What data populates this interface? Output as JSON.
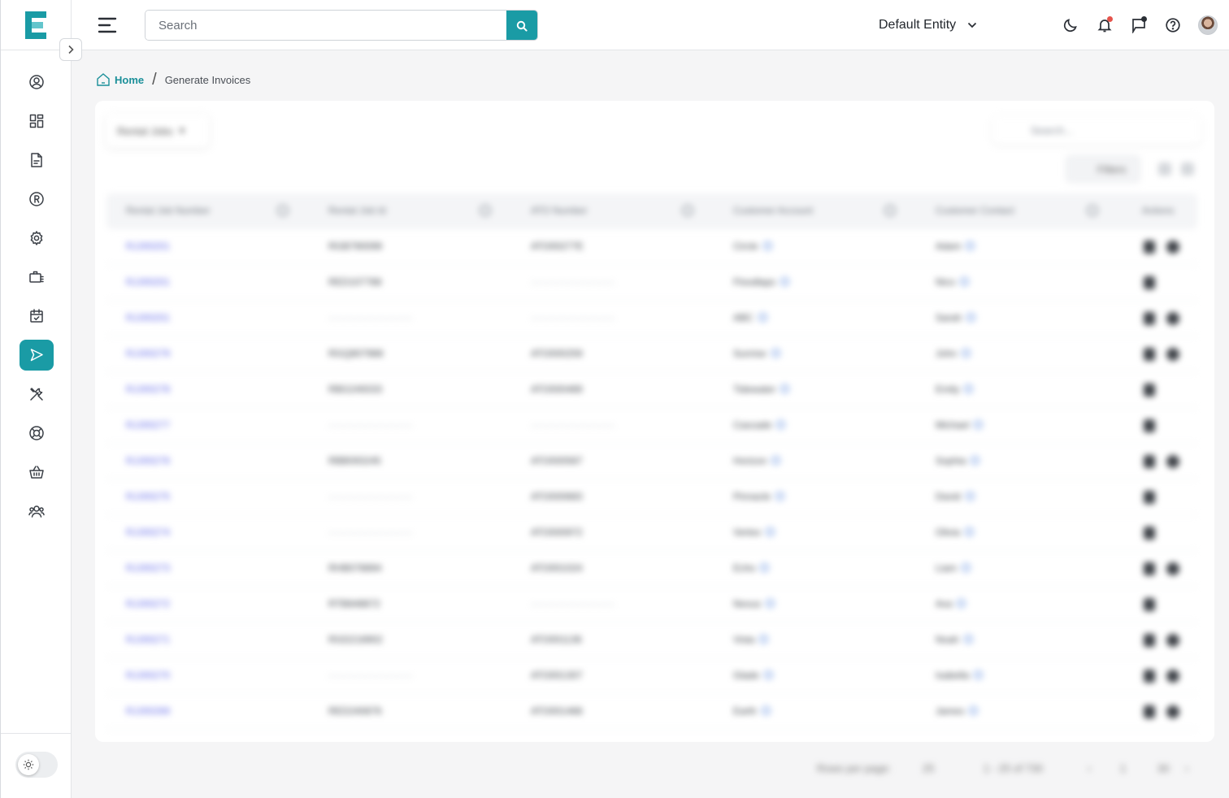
{
  "app": {
    "logo_letter": "E",
    "accent_color": "#1a9ba5"
  },
  "sidebar": {
    "items": [
      {
        "icon": "user-circle-icon",
        "active": false
      },
      {
        "icon": "dashboard-grid-icon",
        "active": false
      },
      {
        "icon": "document-icon",
        "active": false
      },
      {
        "icon": "registered-icon",
        "active": false
      },
      {
        "icon": "gear-icon",
        "active": false
      },
      {
        "icon": "briefcase-icon",
        "active": false
      },
      {
        "icon": "calendar-check-icon",
        "active": false
      },
      {
        "icon": "send-icon",
        "active": true
      },
      {
        "icon": "tools-icon",
        "active": false
      },
      {
        "icon": "lifebuoy-icon",
        "active": false
      },
      {
        "icon": "basket-icon",
        "active": false
      },
      {
        "icon": "users-icon",
        "active": false
      }
    ],
    "theme_toggle_icon": "sun-icon"
  },
  "header": {
    "search_placeholder": "Search",
    "entity_label": "Default Entity",
    "icons": [
      "moon-icon",
      "bell-icon",
      "flag-chat-icon",
      "help-icon",
      "avatar"
    ]
  },
  "breadcrumb": {
    "home": "Home",
    "separator": "/",
    "current": "Generate Invoices"
  },
  "table": {
    "toolbar": {
      "dropdown_label": "Rental Jobs",
      "search_placeholder": "Search...",
      "filters_label": "Filters"
    },
    "columns": [
      "Rental Job Number",
      "Rental Job Id",
      "ATO Number",
      "Customer Account",
      "Customer Contact",
      "Actions"
    ],
    "rows": [
      {
        "job_number": "RJJ00201",
        "job_id": "RGB790099",
        "ato": "ATO00277E",
        "account": "Circle",
        "contact": "Adam",
        "actions": 2
      },
      {
        "job_number": "RJJ00201",
        "job_id": "RED107788",
        "ato": "————————",
        "account": "Floodlaps",
        "contact": "Nico",
        "actions": 1
      },
      {
        "job_number": "RJJ00201",
        "job_id": "————————",
        "ato": "————————",
        "account": "ABC",
        "contact": "Sarah",
        "actions": 2
      },
      {
        "job_number": "RJJ00279",
        "job_id": "RGQ807988",
        "ato": "ATO000259",
        "account": "Sunrise",
        "contact": "John",
        "actions": 2
      },
      {
        "job_number": "RJJ00278",
        "job_id": "RBG249333",
        "ato": "ATO000489",
        "account": "Tidewater",
        "contact": "Emily",
        "actions": 1
      },
      {
        "job_number": "RJJ00277",
        "job_id": "————————",
        "ato": "————————",
        "account": "Cascade",
        "contact": "Michael",
        "actions": 1
      },
      {
        "job_number": "RJJ00276",
        "job_id": "RBB093245",
        "ato": "ATO000587",
        "account": "Horizon",
        "contact": "Sophia",
        "actions": 2
      },
      {
        "job_number": "RJJ00275",
        "job_id": "————————",
        "ato": "ATO000683",
        "account": "Pinnacle",
        "contact": "David",
        "actions": 1
      },
      {
        "job_number": "RJJ00274",
        "job_id": "————————",
        "ato": "ATO000972",
        "account": "Vertex",
        "contact": "Olivia",
        "actions": 1
      },
      {
        "job_number": "RJJ00273",
        "job_id": "RHB078894",
        "ato": "ATO001024",
        "account": "Echo",
        "contact": "Liam",
        "actions": 2
      },
      {
        "job_number": "RJJ00272",
        "job_id": "RTB848872",
        "ato": "————————",
        "account": "Nexus",
        "contact": "Ava",
        "actions": 1
      },
      {
        "job_number": "RJJ00271",
        "job_id": "RGD218902",
        "ato": "ATO001136",
        "account": "Vista",
        "contact": "Noah",
        "actions": 2
      },
      {
        "job_number": "RJJ00270",
        "job_id": "————————",
        "ato": "ATO001307",
        "account": "Glade",
        "contact": "Isabella",
        "actions": 2
      },
      {
        "job_number": "RJJ00269",
        "job_id": "RED240876",
        "ato": "ATO001468",
        "account": "Earth",
        "contact": "James",
        "actions": 2
      }
    ],
    "pagination": {
      "rows_per_page_label": "Rows per page:",
      "rows_per_page": "25",
      "range": "1 - 25 of 730",
      "current_page": "1",
      "last_page": "30"
    }
  }
}
